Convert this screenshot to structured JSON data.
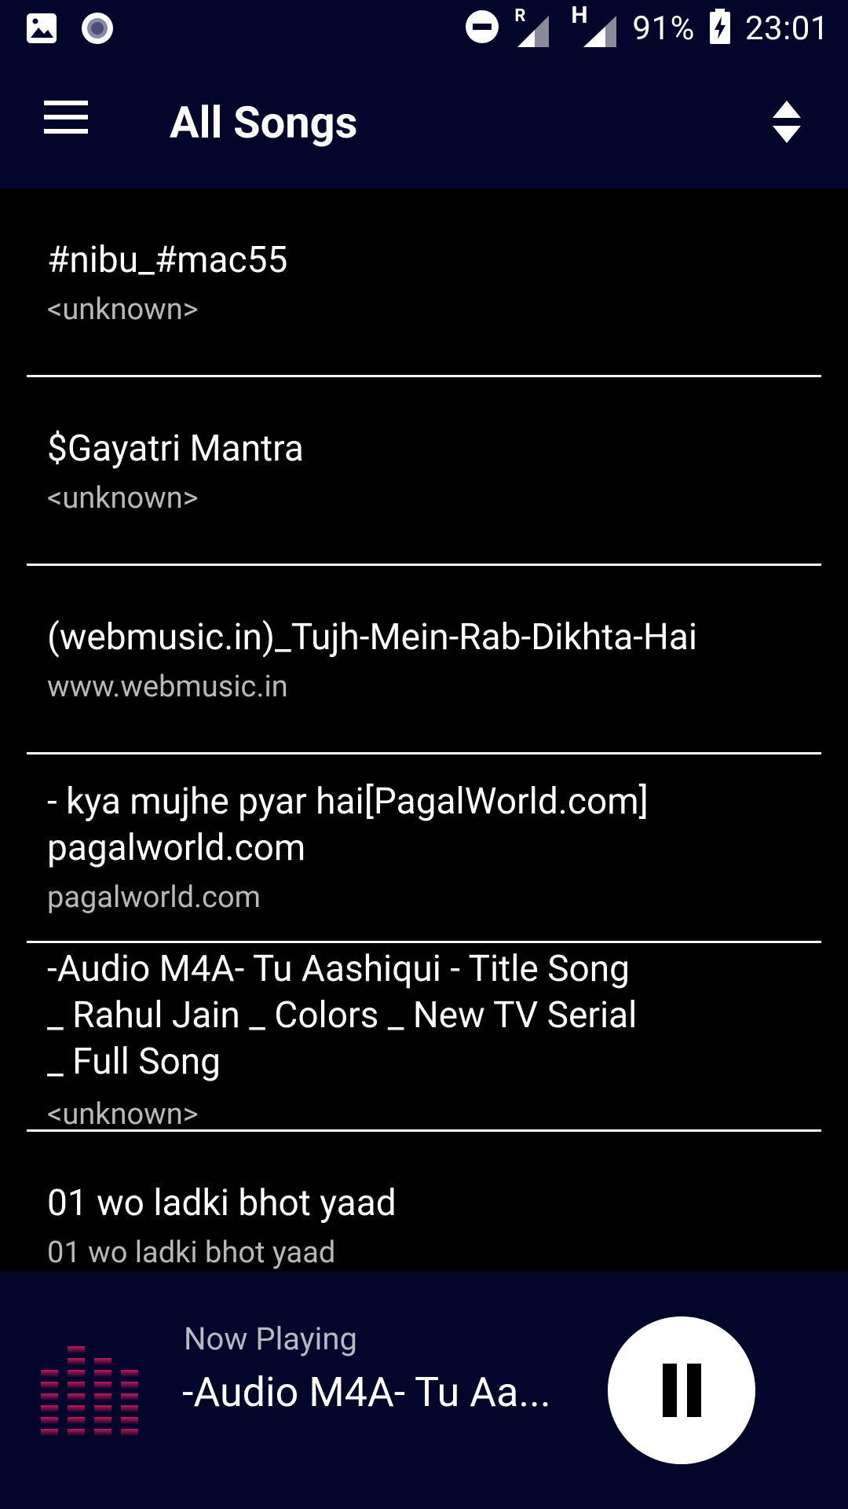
{
  "status_bar": {
    "battery": "91%",
    "time": "23:01",
    "roaming_indicator": "R",
    "network_type": "H",
    "icons": [
      "gallery-icon",
      "circle-notification-icon",
      "do-not-disturb-icon",
      "signal-roaming-icon",
      "signal-icon",
      "battery-charging-icon"
    ]
  },
  "app_bar": {
    "title": "All Songs",
    "icons": [
      "menu-icon",
      "sort-icon"
    ]
  },
  "songs": [
    {
      "title": "#nibu_#mac55",
      "artist": "<unknown>"
    },
    {
      "title": "$Gayatri Mantra",
      "artist": "<unknown>"
    },
    {
      "title": "(webmusic.in)_Tujh-Mein-Rab-Dikhta-Hai",
      "artist": "www.webmusic.in"
    },
    {
      "title": "- kya mujhe pyar hai[PagalWorld.com]\npagalworld.com",
      "artist": "pagalworld.com"
    },
    {
      "title": "-Audio M4A- Tu Aashiqui - Title Song\n_ Rahul Jain _ Colors _ New TV Serial\n_ Full Song",
      "artist": "<unknown>"
    },
    {
      "title": "01 wo ladki bhot yaad",
      "artist": "01 wo ladki bhot yaad"
    }
  ],
  "now_playing": {
    "label": "Now Playing",
    "title": "-Audio M4A- Tu Aa...",
    "state": "playing",
    "icons": [
      "equalizer-icon",
      "pause-icon"
    ]
  },
  "colors": {
    "bar_background": "#03052a",
    "list_background": "#000000",
    "divider": "#ffffff",
    "subtitle": "#b8b8b8",
    "equalizer": "#c2185b"
  }
}
